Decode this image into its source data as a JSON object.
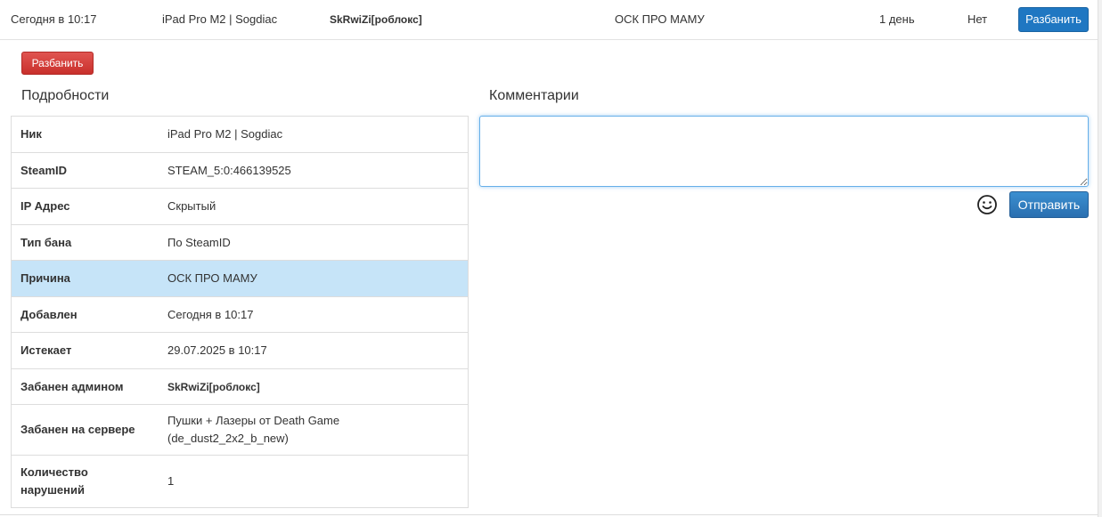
{
  "top_row": {
    "date": "Сегодня в 10:17",
    "nick": "iPad Pro M2 | Sogdiac",
    "admin": "SkRwiZi[роблокс]",
    "reason": "ОСК ПРО МАМУ",
    "length": "1 день",
    "status": "Нет",
    "unban_label": "Разбанить"
  },
  "actions": {
    "unban_label": "Разбанить"
  },
  "details": {
    "title": "Подробности",
    "rows": [
      {
        "key": "Ник",
        "value": "iPad Pro M2 | Sogdiac"
      },
      {
        "key": "SteamID",
        "value": "STEAM_5:0:466139525"
      },
      {
        "key": "IP Адрес",
        "value": "Скрытый"
      },
      {
        "key": "Тип бана",
        "value": "По SteamID"
      },
      {
        "key": "Причина",
        "value": "ОСК ПРО МАМУ"
      },
      {
        "key": "Добавлен",
        "value": "Сегодня в 10:17"
      },
      {
        "key": "Истекает",
        "value": "29.07.2025 в 10:17"
      },
      {
        "key": "Забанен админом",
        "value": "SkRwiZi[роблокс]"
      },
      {
        "key": "Забанен на сервере",
        "value": "Пушки + Лазеры от Death Game (de_dust2_2x2_b_new)"
      },
      {
        "key": "Количество нарушений",
        "value": "1"
      }
    ]
  },
  "comments": {
    "title": "Комментарии",
    "input_value": "",
    "send_label": "Отправить",
    "emoji_icon": "smiley-icon"
  },
  "colors": {
    "primary": "#1f77c2",
    "danger": "#c9302c",
    "highlight_row": "#c6e4f8",
    "focus_border": "#66afe9"
  }
}
